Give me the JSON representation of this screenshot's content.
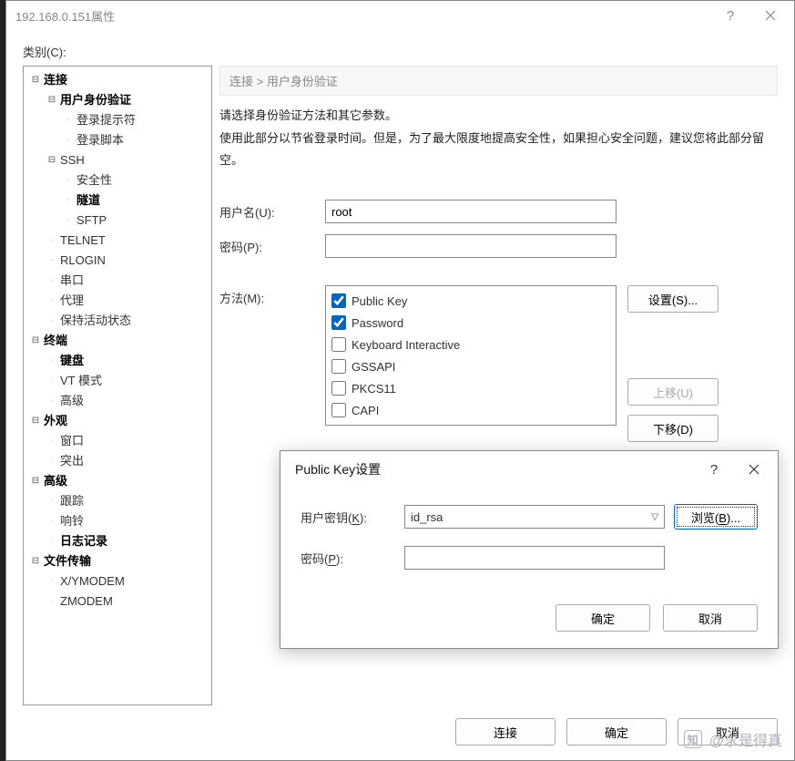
{
  "window": {
    "title": "192.168.0.151属性",
    "help_glyph": "?",
    "category_label": "类别(C):"
  },
  "tree": [
    {
      "indent": 0,
      "toggle": "⊟",
      "label": "连接",
      "bold": true
    },
    {
      "indent": 1,
      "toggle": "⊟",
      "label": "用户身份验证",
      "bold": true
    },
    {
      "indent": 2,
      "toggle": "",
      "label": "登录提示符",
      "bold": false
    },
    {
      "indent": 2,
      "toggle": "",
      "label": "登录脚本",
      "bold": false
    },
    {
      "indent": 1,
      "toggle": "⊟",
      "label": "SSH",
      "bold": false
    },
    {
      "indent": 2,
      "toggle": "",
      "label": "安全性",
      "bold": false
    },
    {
      "indent": 2,
      "toggle": "",
      "label": "隧道",
      "bold": true
    },
    {
      "indent": 2,
      "toggle": "",
      "label": "SFTP",
      "bold": false
    },
    {
      "indent": 1,
      "toggle": "",
      "label": "TELNET",
      "bold": false
    },
    {
      "indent": 1,
      "toggle": "",
      "label": "RLOGIN",
      "bold": false
    },
    {
      "indent": 1,
      "toggle": "",
      "label": "串口",
      "bold": false
    },
    {
      "indent": 1,
      "toggle": "",
      "label": "代理",
      "bold": false
    },
    {
      "indent": 1,
      "toggle": "",
      "label": "保持活动状态",
      "bold": false
    },
    {
      "indent": 0,
      "toggle": "⊟",
      "label": "终端",
      "bold": true
    },
    {
      "indent": 1,
      "toggle": "",
      "label": "键盘",
      "bold": true
    },
    {
      "indent": 1,
      "toggle": "",
      "label": "VT 模式",
      "bold": false
    },
    {
      "indent": 1,
      "toggle": "",
      "label": "高级",
      "bold": false
    },
    {
      "indent": 0,
      "toggle": "⊟",
      "label": "外观",
      "bold": true
    },
    {
      "indent": 1,
      "toggle": "",
      "label": "窗口",
      "bold": false
    },
    {
      "indent": 1,
      "toggle": "",
      "label": "突出",
      "bold": false
    },
    {
      "indent": 0,
      "toggle": "⊟",
      "label": "高级",
      "bold": true
    },
    {
      "indent": 1,
      "toggle": "",
      "label": "跟踪",
      "bold": false
    },
    {
      "indent": 1,
      "toggle": "",
      "label": "响铃",
      "bold": false
    },
    {
      "indent": 1,
      "toggle": "",
      "label": "日志记录",
      "bold": true
    },
    {
      "indent": 0,
      "toggle": "⊟",
      "label": "文件传输",
      "bold": true
    },
    {
      "indent": 1,
      "toggle": "",
      "label": "X/YMODEM",
      "bold": false
    },
    {
      "indent": 1,
      "toggle": "",
      "label": "ZMODEM",
      "bold": false
    }
  ],
  "breadcrumb": "连接 > 用户身份验证",
  "description": {
    "line1": "请选择身份验证方法和其它参数。",
    "line2": "使用此部分以节省登录时间。但是，为了最大限度地提高安全性，如果担心安全问题，建议您将此部分留空。"
  },
  "form": {
    "username_label": "用户名(U):",
    "username_value": "root",
    "password_label": "密码(P):",
    "password_value": "",
    "method_label": "方法(M):"
  },
  "methods": [
    {
      "name": "Public Key",
      "checked": true
    },
    {
      "name": "Password",
      "checked": true
    },
    {
      "name": "Keyboard Interactive",
      "checked": false
    },
    {
      "name": "GSSAPI",
      "checked": false
    },
    {
      "name": "PKCS11",
      "checked": false
    },
    {
      "name": "CAPI",
      "checked": false
    }
  ],
  "side_buttons": {
    "settings": "设置(S)...",
    "move_up": "上移(U)",
    "move_down": "下移(D)"
  },
  "bottom_buttons": {
    "connect": "连接",
    "ok": "确定",
    "cancel": "取消"
  },
  "modal": {
    "title": "Public Key设置",
    "help_glyph": "?",
    "user_key_label_prefix": "用户密钥(",
    "user_key_hotkey": "K",
    "user_key_label_suffix": "):",
    "user_key_value": "id_rsa",
    "browse_prefix": "浏览(",
    "browse_hotkey": "B",
    "browse_suffix": ")...",
    "password_label_prefix": "密码(",
    "password_hotkey": "P",
    "password_label_suffix": "):",
    "password_value": "",
    "ok": "确定",
    "cancel": "取消"
  },
  "watermark": {
    "icon_text": "知",
    "text": "@求是得真"
  }
}
